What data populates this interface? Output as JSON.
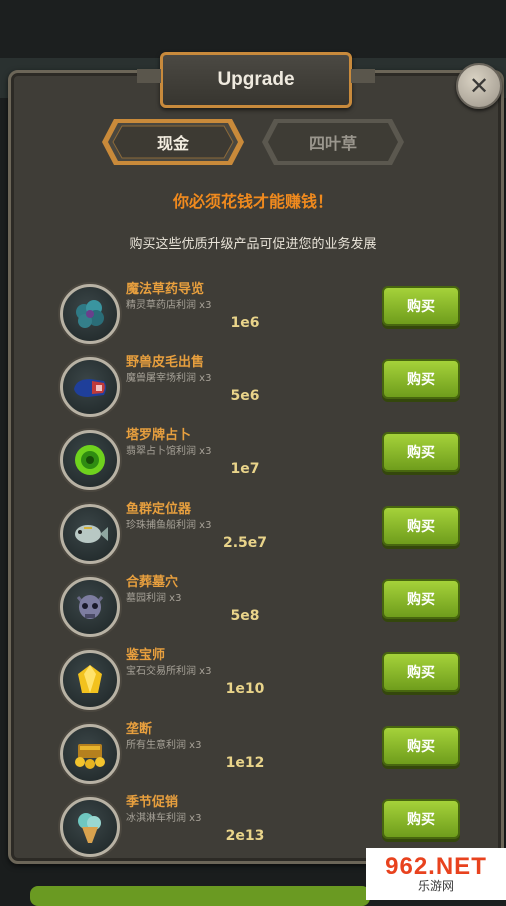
{
  "window": {
    "title": "Upgrade",
    "close_icon": "close-icon"
  },
  "tabs": [
    {
      "label": "现金",
      "active": true
    },
    {
      "label": "四叶草",
      "active": false
    }
  ],
  "headline": "你必须花钱才能赚钱！",
  "subline": "购买这些优质升级产品可促进您的业务发展",
  "colors": {
    "accent_orange": "#f08a1e",
    "buy_green": "#8cbc2c",
    "panel_bg": "#3f3d37",
    "title_border": "#c88a3c"
  },
  "upgrades": [
    {
      "name": "魔法草药导览",
      "desc": "精灵草药店利润 x3",
      "price": "1e6",
      "button": "购买",
      "icon": "herb-bush-icon"
    },
    {
      "name": "野兽皮毛出售",
      "desc": "魔兽屠宰场利润 x3",
      "price": "5e6",
      "button": "购买",
      "icon": "meat-hide-icon"
    },
    {
      "name": "塔罗牌占卜",
      "desc": "翡翠占卜馆利润 x3",
      "price": "1e7",
      "button": "购买",
      "icon": "green-orb-icon"
    },
    {
      "name": "鱼群定位器",
      "desc": "珍珠捕鱼船利润 x3",
      "price": "2.5e7",
      "button": "购买",
      "icon": "fish-icon"
    },
    {
      "name": "合葬墓穴",
      "desc": "墓园利润 x3",
      "price": "5e8",
      "button": "购买",
      "icon": "skull-icon"
    },
    {
      "name": "鉴宝师",
      "desc": "宝石交易所利润 x3",
      "price": "1e10",
      "button": "购买",
      "icon": "gem-icon"
    },
    {
      "name": "垄断",
      "desc": "所有生意利润 x3",
      "price": "1e12",
      "button": "购买",
      "icon": "gold-chest-icon"
    },
    {
      "name": "季节促销",
      "desc": "冰淇淋车利润 x3",
      "price": "2e13",
      "button": "购买",
      "icon": "ice-cream-icon"
    }
  ],
  "watermark": {
    "top": "962.NET",
    "bottom": "乐游网"
  }
}
